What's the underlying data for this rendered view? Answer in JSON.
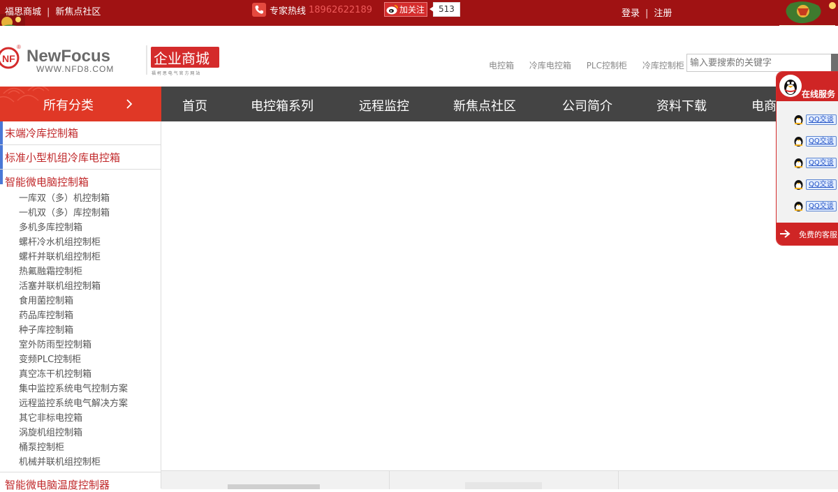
{
  "topbar": {
    "site_link": "福思商城",
    "community_link": "新焦点社区",
    "hotline_label": "专家热线",
    "hotline_number": "18962622189",
    "weibo_follow": "加关注",
    "weibo_count": "513",
    "login": "登录",
    "register": "注册"
  },
  "header": {
    "logo_brand": "NewFocus",
    "logo_url_text": "WWW.NFD8.COM",
    "logo_mall": "企业商城",
    "logo_tagline": "福 柯 思 电 气 官 方 网 站",
    "quick_links": [
      "电控箱",
      "冷库电控箱",
      "PLC控制柜",
      "冷库控制柜"
    ],
    "search_placeholder": "输入要搜索的关键字"
  },
  "nav": {
    "all_categories": "所有分类",
    "items": [
      "首页",
      "电控箱系列",
      "远程监控",
      "新焦点社区",
      "公司简介",
      "资料下载",
      "电商"
    ]
  },
  "sidebar": {
    "cat1": "末端冷库控制箱",
    "cat2": "标准小型机组冷库电控箱",
    "cat3": "智能微电脑控制箱",
    "cat4": "智能微电脑温度控制器",
    "subitems": [
      "一库双（多）机控制箱",
      "一机双（多）库控制箱",
      "多机多库控制箱",
      "螺杆冷水机组控制柜",
      "螺杆并联机组控制柜",
      "热氟融霜控制柜",
      "活塞并联机组控制箱",
      "食用菌控制箱",
      "药品库控制箱",
      "种子库控制箱",
      "室外防雨型控制箱",
      "变频PLC控制柜",
      "真空冻干机控制箱",
      "集中监控系统电气控制方案",
      "远程监控系统电气解决方案",
      "其它非标电控箱",
      "涡旋机组控制箱",
      "桶泵控制柜",
      "机械并联机组控制柜"
    ]
  },
  "online_service": {
    "title": "在线服务",
    "qq_buttons": [
      "QQ交谈",
      "QQ交谈",
      "QQ交谈",
      "QQ交谈",
      "QQ交谈"
    ],
    "footer_text": "免费的客服"
  },
  "colors": {
    "topbar_bg": "#a01213",
    "nav_bg": "#444444",
    "all_categories_bg": "#e03826",
    "category_text": "#c0282a",
    "service_red": "#cf2525"
  },
  "icons": [
    "phone-icon",
    "weibo-icon",
    "chevron-right-icon",
    "qq-penguin-icon",
    "arrow-right-icon"
  ]
}
